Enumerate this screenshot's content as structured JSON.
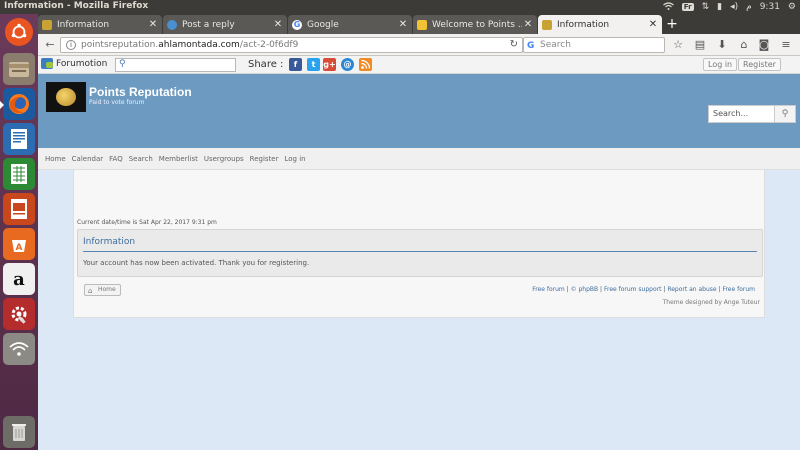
{
  "system": {
    "window_title": "Information - Mozilla Firefox",
    "keyboard": "Fr",
    "time": "9:31",
    "period": "م"
  },
  "tabs": [
    {
      "label": "Information",
      "active": false
    },
    {
      "label": "Post a reply",
      "active": false
    },
    {
      "label": "Google",
      "active": false
    },
    {
      "label": "Welcome to Points ...",
      "active": false
    },
    {
      "label": "Information",
      "active": true
    }
  ],
  "navbar": {
    "url_prefix": "pointsreputation.",
    "url_domain": "ahlamontada.com",
    "url_path": "/act-2-0f6df9",
    "search_placeholder": "Search"
  },
  "forumbar": {
    "brand": "Forumotion",
    "share_label": "Share :",
    "share_icons": [
      "f",
      "t",
      "g+",
      "@",
      "rss"
    ],
    "login": "Log in",
    "register": "Register"
  },
  "site": {
    "title": "Points Reputation",
    "description": "Paid to vote forum",
    "search_placeholder": "Search..."
  },
  "menu": [
    "Home",
    "Calendar",
    "FAQ",
    "Search",
    "Memberlist",
    "Usergroups",
    "Register",
    "Log in"
  ],
  "content": {
    "datetime": "Current date/time is Sat Apr 22, 2017 9:31 pm",
    "info_title": "Information",
    "info_message": "Your account has now been activated. Thank you for registering.",
    "home_button": "Home",
    "footer_links": [
      "Free forum",
      "© phpBB",
      "Free forum support",
      "Report an abuse",
      "Free forum"
    ],
    "theme_credit": "Theme designed by Ange Tuteur"
  }
}
